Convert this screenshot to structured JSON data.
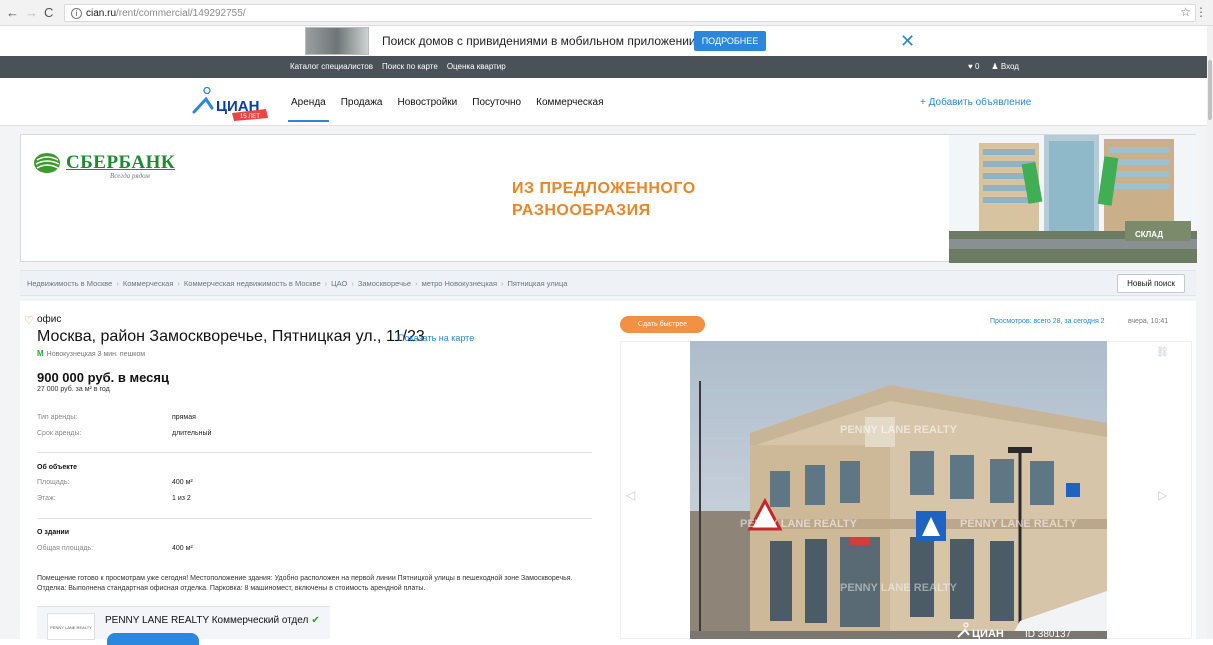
{
  "browser": {
    "url_host": "cian.ru",
    "url_path": "/rent/commercial/149292755/"
  },
  "promo": {
    "text": "Поиск домов с привидениями в мобильном приложении ЦИАН",
    "button": "ПОДРОБНЕЕ"
  },
  "topnav": {
    "links": [
      "Каталог специалистов",
      "Поиск по карте",
      "Оценка квартир"
    ],
    "favorites": "♥ 0",
    "login": "Вход"
  },
  "header": {
    "logo": "ЦИАН",
    "logo_badge": "15 ЛЕТ",
    "menu": [
      "Аренда",
      "Продажа",
      "Новостройки",
      "Посуточно",
      "Коммерческая"
    ],
    "add": "+ Добавить объявление"
  },
  "banner": {
    "brand": "СБЕРБАНК",
    "tagline": "Всегда рядом",
    "slogan_1": "ИЗ ПРЕДЛОЖЕННОГО",
    "slogan_2": "РАЗНООБРАЗИЯ",
    "sign": "СКЛАД"
  },
  "breadcrumbs": [
    "Недвижимость в Москве",
    "Коммерческая",
    "Коммерческая недвижимость в Москве",
    "ЦАО",
    "Замоскворечье",
    "метро Новокузнецкая",
    "Пятницкая улица"
  ],
  "new_search": "Новый поиск",
  "listing": {
    "type": "офис",
    "address": "Москва, район Замоскворечье, Пятницкая ул., 11/23",
    "map_link": "Показать на карте",
    "metro": "Новокузнецкая 3 мин. пешком",
    "price": "900 000 руб. в месяц",
    "price_sub": "27 000 руб. за м² в год",
    "rent_rows": [
      {
        "label": "Тип аренды:",
        "value": "прямая"
      },
      {
        "label": "Срок аренды:",
        "value": "длительный"
      }
    ],
    "object_title": "Об объекте",
    "object_rows": [
      {
        "label": "Площадь:",
        "value": "400 м²"
      },
      {
        "label": "Этаж:",
        "value": "1 из 2"
      }
    ],
    "building_title": "О здании",
    "building_rows": [
      {
        "label": "Общая площадь:",
        "value": "400 м²"
      }
    ],
    "description": "Помещение готово к просмотрам уже сегодня! Местоположение здания: Удобно расположен на первой линии Пятницкой улицы в пешеходной зоне Замосквоpечья. Отделка: Выполнена стандартная офисная отделка. Парковка: 8 машиномест, включены в стоимость арендной платы.",
    "agent": "PENNY LANE REALTY Коммерческий отдел",
    "agent_logo": "PENNY LANE REALTY"
  },
  "right": {
    "rent_faster": "Сдать быстрее",
    "views": "Просмотров: всего 28, за сегодня 2",
    "time": "вчера, 10:41",
    "watermark": "PENNY LANE REALTY",
    "watermark_id": "ID 380137",
    "photo_logo": "ЦИАН"
  }
}
